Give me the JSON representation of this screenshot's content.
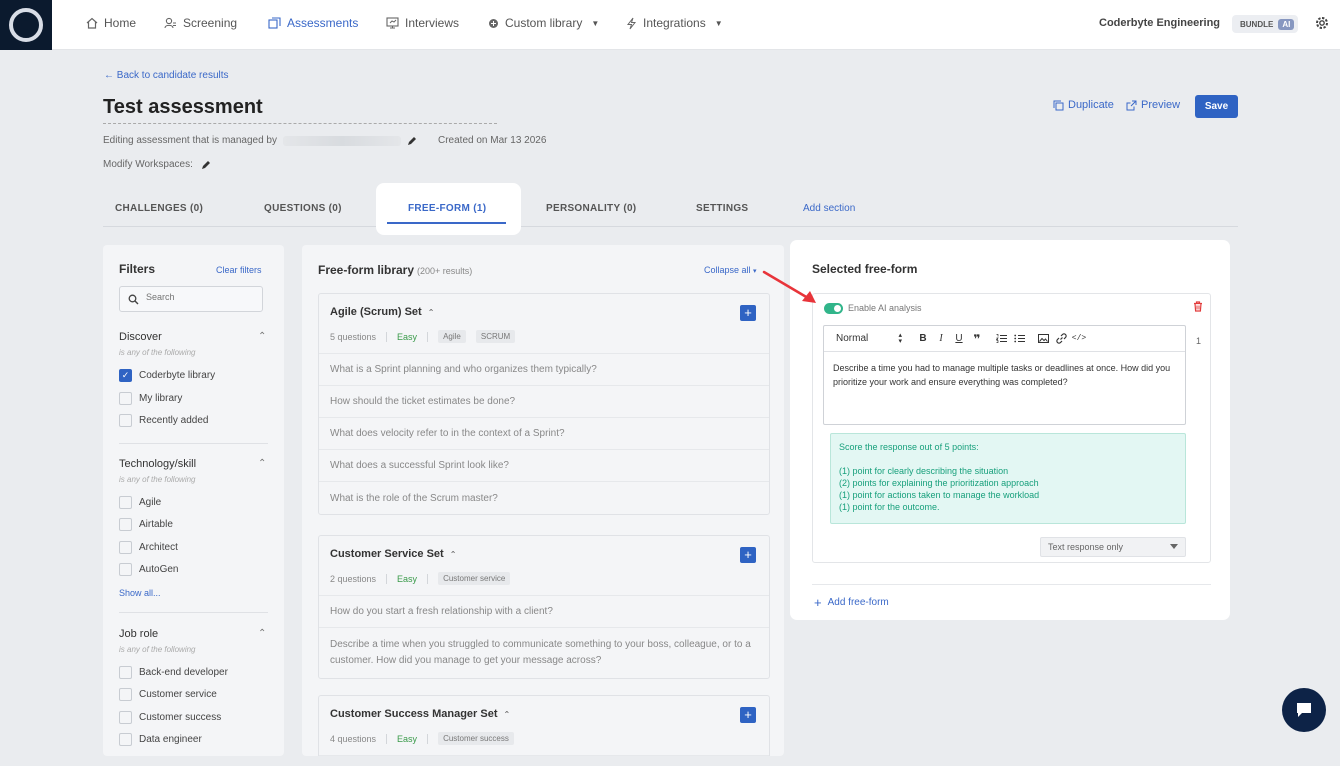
{
  "nav": {
    "items": [
      {
        "label": "Home",
        "icon": "home-icon"
      },
      {
        "label": "Screening",
        "icon": "screening-icon"
      },
      {
        "label": "Assessments",
        "icon": "assessments-icon"
      },
      {
        "label": "Interviews",
        "icon": "interviews-icon"
      },
      {
        "label": "Custom library",
        "icon": "library-icon"
      },
      {
        "label": "Integrations",
        "icon": "bolt-icon"
      }
    ],
    "org_name": "Coderbyte Engineering",
    "bundle_label": "BUNDLE",
    "ai_label": "AI"
  },
  "header": {
    "back_link": "← Back to candidate results",
    "title": "Test assessment",
    "managed_by": "Editing assessment that is managed by",
    "created": "Created on Mar 13 2026",
    "modify_workspaces": "Modify Workspaces:",
    "duplicate": "Duplicate",
    "preview": "Preview",
    "save": "Save"
  },
  "tabs": {
    "challenges": "CHALLENGES (0)",
    "questions": "QUESTIONS (0)",
    "free_form": "FREE-FORM (1)",
    "personality": "PERSONALITY (0)",
    "settings": "SETTINGS",
    "add_section": "Add section"
  },
  "filters": {
    "title": "Filters",
    "clear": "Clear filters",
    "search_placeholder": "Search",
    "groups": [
      {
        "title": "Discover",
        "subtitle": "is any of the following",
        "options": [
          {
            "label": "Coderbyte library",
            "checked": true
          },
          {
            "label": "My library",
            "checked": false
          },
          {
            "label": "Recently added",
            "checked": false
          }
        ]
      },
      {
        "title": "Technology/skill",
        "subtitle": "is any of the following",
        "options": [
          {
            "label": "Agile",
            "checked": false
          },
          {
            "label": "Airtable",
            "checked": false
          },
          {
            "label": "Architect",
            "checked": false
          },
          {
            "label": "AutoGen",
            "checked": false
          }
        ],
        "show_all": "Show all..."
      },
      {
        "title": "Job role",
        "subtitle": "is any of the following",
        "options": [
          {
            "label": "Back-end developer",
            "checked": false
          },
          {
            "label": "Customer service",
            "checked": false
          },
          {
            "label": "Customer success",
            "checked": false
          },
          {
            "label": "Data engineer",
            "checked": false
          }
        ]
      }
    ]
  },
  "library": {
    "title": "Free-form library",
    "count": "(200+ results)",
    "collapse_all": "Collapse all",
    "sets": [
      {
        "name": "Agile (Scrum) Set",
        "count": "5 questions",
        "difficulty": "Easy",
        "tags": [
          "Agile",
          "SCRUM"
        ],
        "questions": [
          "What is a Sprint planning and who organizes them typically?",
          "How should the ticket estimates be done?",
          "What does velocity refer to in the context of a Sprint?",
          "What does a successful Sprint look like?",
          "What is the role of the Scrum master?"
        ]
      },
      {
        "name": "Customer Service Set",
        "count": "2 questions",
        "difficulty": "Easy",
        "tags": [
          "Customer service"
        ],
        "questions": [
          "How do you start a fresh relationship with a client?",
          "Describe a time when you struggled to communicate something to your boss, colleague, or to a customer. How did you manage to get your message across?"
        ]
      },
      {
        "name": "Customer Success Manager Set",
        "count": "4 questions",
        "difficulty": "Easy",
        "tags": [
          "Customer success"
        ],
        "questions": []
      }
    ]
  },
  "selected": {
    "title": "Selected free-form",
    "ai_toggle_label": "Enable AI analysis",
    "ai_enabled": true,
    "format": "Normal",
    "question_text": "Describe a time you had to manage multiple tasks or deadlines at once. How did you prioritize your work and ensure everything was completed?",
    "question_number": "1",
    "rubric_lines": [
      "Score the response out of 5 points:",
      "",
      "(1) point for clearly describing the situation",
      "(2) points for explaining the prioritization approach",
      "(1) point for actions taken to manage the workload",
      "(1) point for the outcome."
    ],
    "response_type": "Text response only",
    "add_label": "Add free-form"
  },
  "colors": {
    "accent": "#3a68c8",
    "save_button": "#2f63c3",
    "toggle_on": "#31b58a",
    "rubric_bg": "#e3f7f3",
    "rubric_text": "#18a07c",
    "annotation_arrow": "#e8343a"
  }
}
